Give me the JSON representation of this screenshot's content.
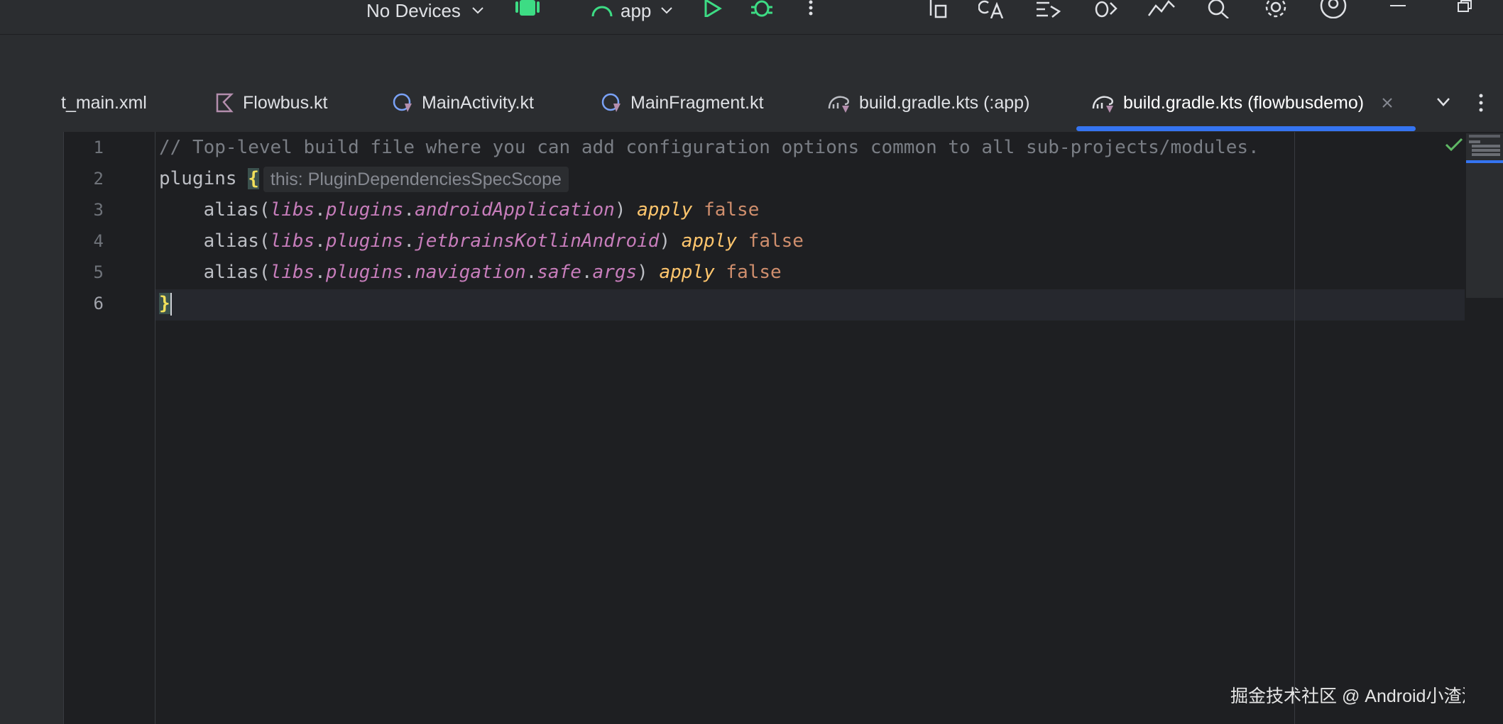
{
  "toolbar": {
    "device_selector": "No Devices",
    "run_config": "app"
  },
  "tabs": [
    {
      "label": "t_main.xml"
    },
    {
      "label": "Flowbus.kt"
    },
    {
      "label": "MainActivity.kt"
    },
    {
      "label": "MainFragment.kt"
    },
    {
      "label": "build.gradle.kts (:app)"
    },
    {
      "label": "build.gradle.kts (flowbusdemo)",
      "active": true
    }
  ],
  "editor": {
    "line_numbers": [
      "1",
      "2",
      "3",
      "4",
      "5",
      "6"
    ],
    "line1_comment": "// Top-level build file where you can add configuration options common to all sub-projects/modules.",
    "line2_keyword": "plugins",
    "line2_brace": "{",
    "line2_hint": "this: PluginDependenciesSpecScope",
    "alias": "alias(",
    "close_paren": ")",
    "apply": "apply",
    "false": "false",
    "dot": ".",
    "libs": "libs",
    "plugins_ref": "plugins",
    "line3_ref": "androidApplication",
    "line4_ref": "jetbrainsKotlinAndroid",
    "line5_ref_a": "navigation",
    "line5_ref_b": "safe",
    "line5_ref_c": "args",
    "line6_brace": "}"
  },
  "watermark": "掘金技术社区 @ Android小渣渣",
  "colors": {
    "accent": "#3574f0",
    "android_green": "#3ddc84",
    "comment": "#7a7e85",
    "keyword": "#cf8e6d",
    "reference": "#c77dbb"
  }
}
